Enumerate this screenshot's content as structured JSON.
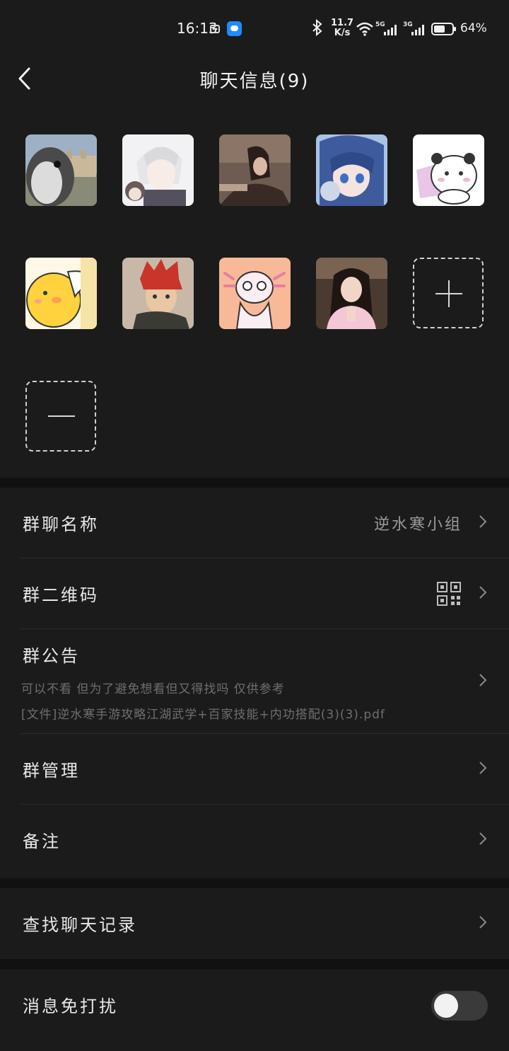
{
  "status_bar": {
    "time": "16:13",
    "speed_value": "11.7",
    "speed_unit": "K/s",
    "net1": "5G",
    "net2": "3G",
    "battery_percent": "64%",
    "battery_level": 0.64
  },
  "header": {
    "title": "聊天信息(9)"
  },
  "members": [
    {
      "name": "",
      "avatar_icon": "penguin-avatar"
    },
    {
      "name": "",
      "avatar_icon": "anime-boy-avatar"
    },
    {
      "name": "",
      "avatar_icon": "photo-avatar"
    },
    {
      "name": "",
      "avatar_icon": "anime-girl-avatar"
    },
    {
      "name": "",
      "avatar_icon": "panda-avatar"
    },
    {
      "name": "",
      "avatar_icon": "duck-avatar"
    },
    {
      "name": "",
      "avatar_icon": "redhair-boy-avatar"
    },
    {
      "name": "",
      "avatar_icon": "axolotl-avatar"
    },
    {
      "name": "",
      "avatar_icon": "girl-photo-avatar"
    }
  ],
  "settings": {
    "group_name_label": "群聊名称",
    "group_name_value": "逆水寒小组",
    "qr_label": "群二维码",
    "notice_label": "群公告",
    "notice_line1": "可以不看 但为了避免想看但又得找吗 仅供参考",
    "notice_line2": "[文件]逆水寒手游攻略江湖武学+百家技能+内功搭配(3)(3).pdf",
    "manage_label": "群管理",
    "remark_label": "备注",
    "search_label": "查找聊天记录",
    "mute_label": "消息免打扰",
    "mute_on": false
  },
  "colors": {
    "background": "#111111",
    "panel": "#1b1b1b",
    "accent_app_icon": "#1e8cff"
  }
}
